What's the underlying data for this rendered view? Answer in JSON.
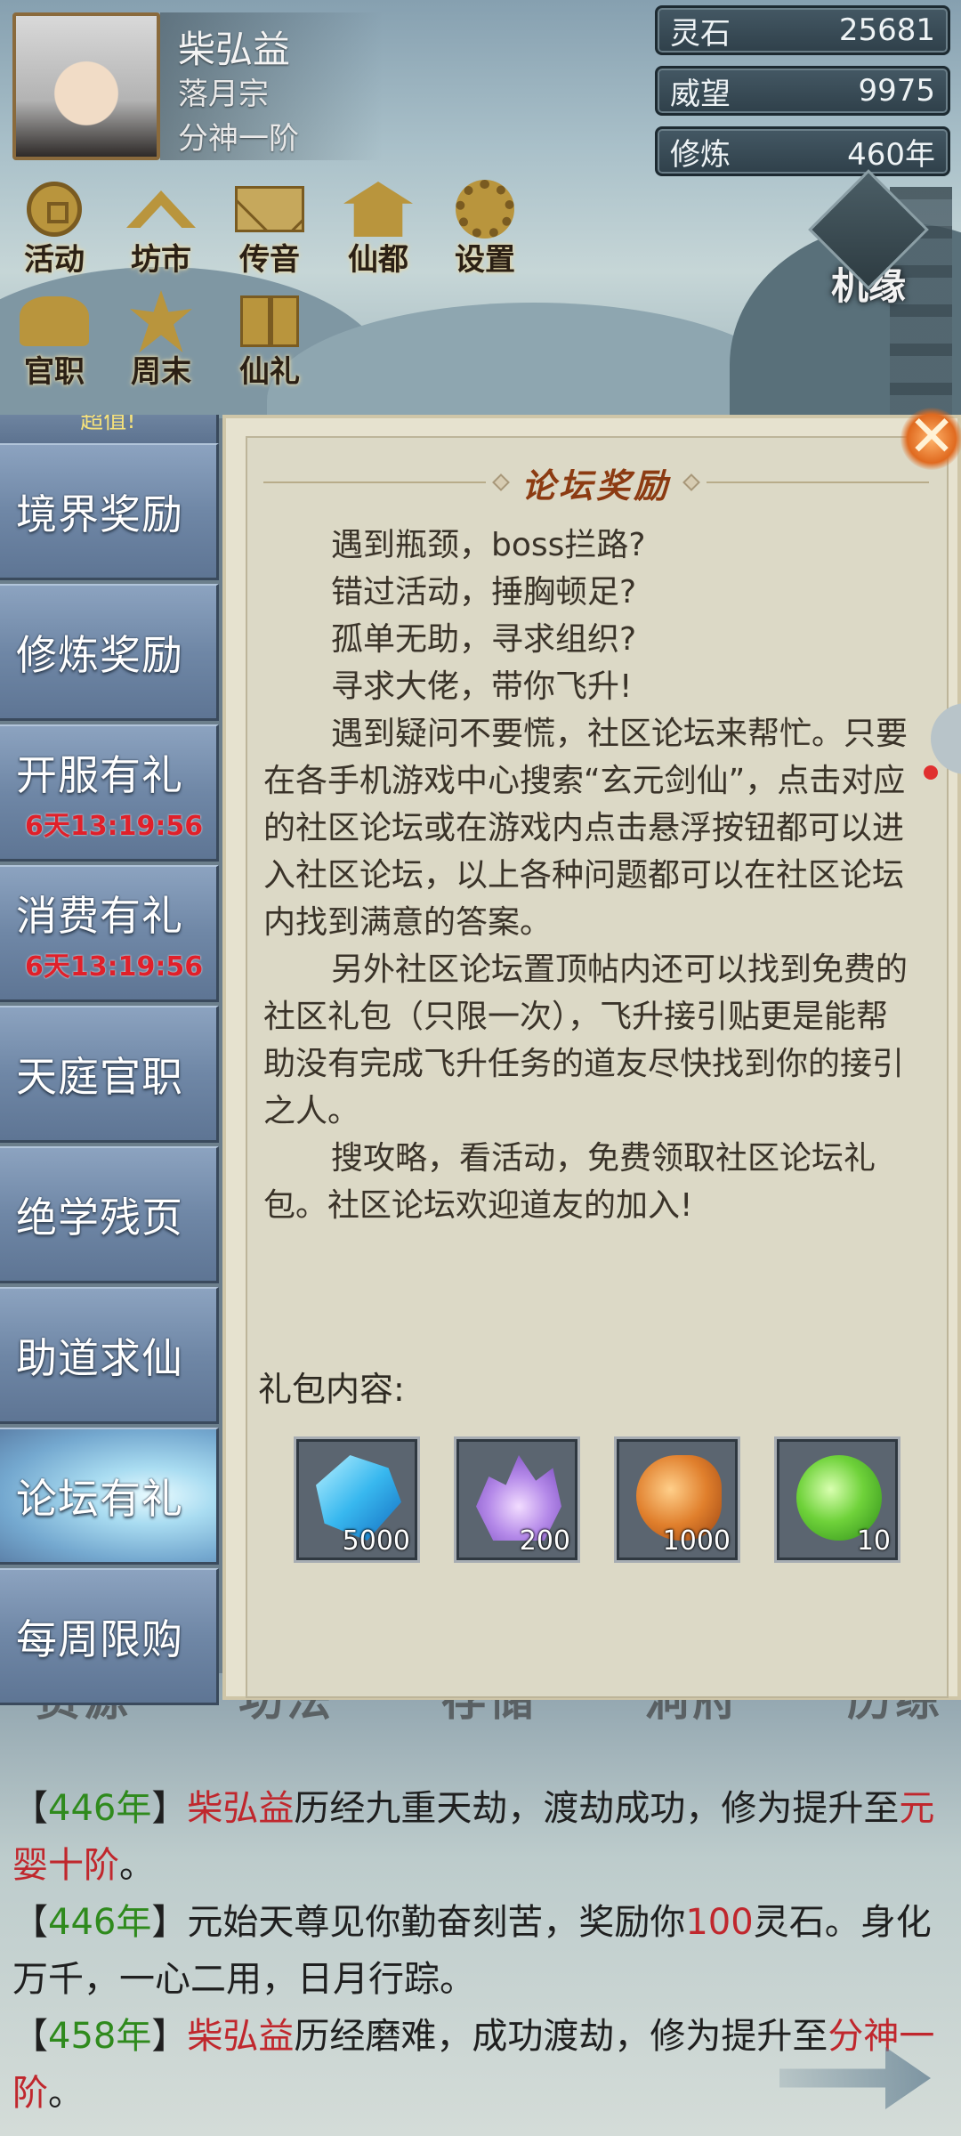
{
  "character": {
    "name": "柴弘益",
    "sect": "落月宗",
    "rank": "分神一阶"
  },
  "resources": [
    {
      "label": "灵石",
      "value": "25681"
    },
    {
      "label": "威望",
      "value": "9975"
    },
    {
      "label": "修炼",
      "value": "460年"
    }
  ],
  "menu": {
    "row1": [
      {
        "label": "活动",
        "icon": "coin-icon"
      },
      {
        "label": "坊市",
        "icon": "market-icon"
      },
      {
        "label": "传音",
        "icon": "envelope-icon"
      },
      {
        "label": "仙都",
        "icon": "hall-icon"
      },
      {
        "label": "设置",
        "icon": "gear-icon"
      }
    ],
    "row2": [
      {
        "label": "官职",
        "icon": "official-hat-icon"
      },
      {
        "label": "周末",
        "icon": "leaf-icon"
      },
      {
        "label": "仙礼",
        "icon": "gift-icon"
      }
    ],
    "fate": "机缘"
  },
  "sidebar": {
    "top_partial": "超值!",
    "tabs": [
      {
        "label": "境界奖励"
      },
      {
        "label": "修炼奖励"
      },
      {
        "label": "开服有礼",
        "timer": "6天13:19:56"
      },
      {
        "label": "消费有礼",
        "timer": "6天13:19:56"
      },
      {
        "label": "天庭官职"
      },
      {
        "label": "绝学残页"
      },
      {
        "label": "助道求仙"
      },
      {
        "label": "论坛有礼",
        "active": true
      },
      {
        "label": "每周限购"
      }
    ]
  },
  "panel": {
    "title": "论坛奖励",
    "close": "✕",
    "paragraphs": [
      "遇到瓶颈，boss拦路?",
      "错过活动，捶胸顿足?",
      "孤单无助，寻求组织?",
      "寻求大佬，带你飞升!",
      "遇到疑问不要慌，社区论坛来帮忙。只要在各手机游戏中心搜索“玄元剑仙”，点击对应的社区论坛或在游戏内点击悬浮按钮都可以进入社区论坛，以上各种问题都可以在社区论坛内找到满意的答案。",
      "另外社区论坛置顶帖内还可以找到免费的社区礼包（只限一次），飞升接引贴更是能帮助没有完成飞升任务的道友尽快找到你的接引之人。",
      "搜攻略，看活动，免费领取社区论坛礼包。社区论坛欢迎道友的加入!"
    ],
    "gift_label": "礼包内容:",
    "gifts": [
      {
        "name": "spirit-crystal-icon",
        "qty": "5000"
      },
      {
        "name": "purple-flame-icon",
        "qty": "200"
      },
      {
        "name": "roast-meat-icon",
        "qty": "1000"
      },
      {
        "name": "green-pill-icon",
        "qty": "10"
      }
    ]
  },
  "bottom_tabs": [
    "资源",
    "功法",
    "存储",
    "洞府",
    "历练"
  ],
  "log": [
    [
      {
        "t": "【",
        "c": ""
      },
      {
        "t": "446年",
        "c": "y"
      },
      {
        "t": "】",
        "c": ""
      },
      {
        "t": "柴弘益",
        "c": "r"
      },
      {
        "t": "历经九重天劫，渡劫成功，修为提升至",
        "c": ""
      },
      {
        "t": "元婴十阶",
        "c": "r"
      },
      {
        "t": "。",
        "c": ""
      }
    ],
    [
      {
        "t": "【",
        "c": ""
      },
      {
        "t": "446年",
        "c": "y"
      },
      {
        "t": "】",
        "c": ""
      },
      {
        "t": "元始天尊见你勤奋刻苦，奖励你",
        "c": ""
      },
      {
        "t": "100",
        "c": "r"
      },
      {
        "t": "灵石。身化万千，一心二用，日月行踪。",
        "c": ""
      }
    ],
    [
      {
        "t": "【",
        "c": ""
      },
      {
        "t": "458年",
        "c": "y"
      },
      {
        "t": "】",
        "c": ""
      },
      {
        "t": "柴弘益",
        "c": "r"
      },
      {
        "t": "历经磨难，成功渡劫，修为提升至",
        "c": ""
      },
      {
        "t": "分神一阶",
        "c": "r"
      },
      {
        "t": "。",
        "c": ""
      }
    ]
  ]
}
